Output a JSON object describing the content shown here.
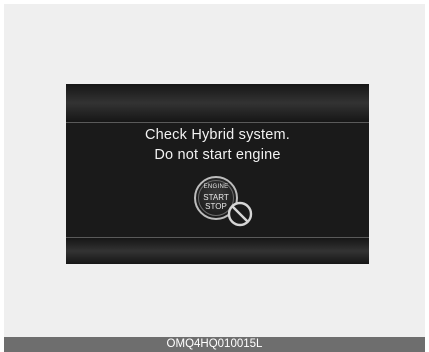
{
  "display": {
    "message_line1": "Check Hybrid system.",
    "message_line2": "Do not start engine",
    "engine_button": {
      "line1": "ENGINE",
      "line2": "START",
      "line3": "STOP"
    },
    "icon": "prohibit-icon"
  },
  "caption": {
    "code": "OMQ4HQ010015L"
  },
  "colors": {
    "screen": "#1a1a1a",
    "text": "#f2f2f2",
    "frame": "#efefef",
    "caption_bar": "#6e6e6e"
  }
}
